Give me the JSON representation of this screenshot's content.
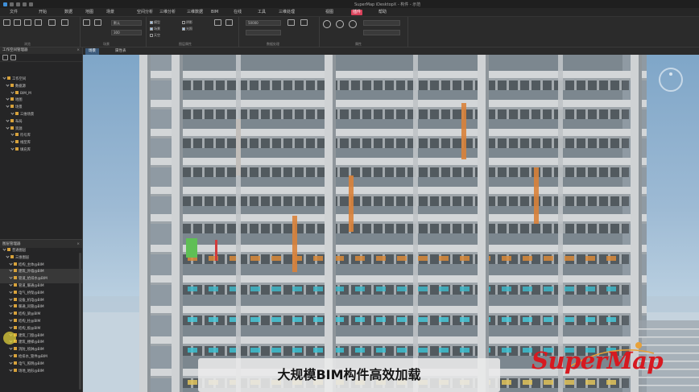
{
  "window": {
    "title": "SuperMap iDesktopX - 构件 - 示范"
  },
  "menu": {
    "items": [
      "文件",
      "开始",
      "数据",
      "地图",
      "场景",
      "空间分析",
      "三维分析",
      "三维数据",
      "BIM",
      "在线",
      "工具",
      "三维处理",
      "视图",
      "插件",
      "帮助"
    ],
    "active_index": 13
  },
  "ribbon": {
    "groups": [
      {
        "label": "浏览"
      },
      {
        "label": "场景"
      },
      {
        "label": "图层属性"
      },
      {
        "label": "数据处理"
      },
      {
        "label": "属性"
      }
    ],
    "fields": [
      "默认",
      "300",
      "50000"
    ],
    "checks": [
      "模型",
      "场景",
      "天空",
      "阴影",
      "光照"
    ]
  },
  "workspace_panel": {
    "title": "工作空间管理器",
    "items": [
      "工作空间",
      "数据源",
      "BIM_M",
      "地图",
      "场景",
      "三维场景",
      "布局",
      "资源",
      "符号库",
      "线型库",
      "填充库"
    ]
  },
  "layer_panel": {
    "title": "图层管理器",
    "items": [
      "普通图层",
      "三维图层",
      "结构_主体@BIM",
      "建筑_外墙@BIM",
      "管道_给排水@BIM",
      "管道_暖通@BIM",
      "电气_桥架@BIM",
      "设备_机电@BIM",
      "暖通_风管@BIM",
      "结构_梁@BIM",
      "结构_柱@BIM",
      "结构_板@BIM",
      "建筑_门窗@BIM",
      "建筑_楼梯@BIM",
      "消防_喷淋@BIM",
      "给排水_管件@BIM",
      "电气_照明@BIM",
      "场地_地形@BIM"
    ]
  },
  "tabs": [
    {
      "label": "场景",
      "active": true
    },
    {
      "label": "属性表",
      "active": false
    }
  ],
  "scene": {
    "caption": "大规模BIM构件高效加载",
    "logo_text": "SuperMap",
    "accent": "#d71920"
  }
}
